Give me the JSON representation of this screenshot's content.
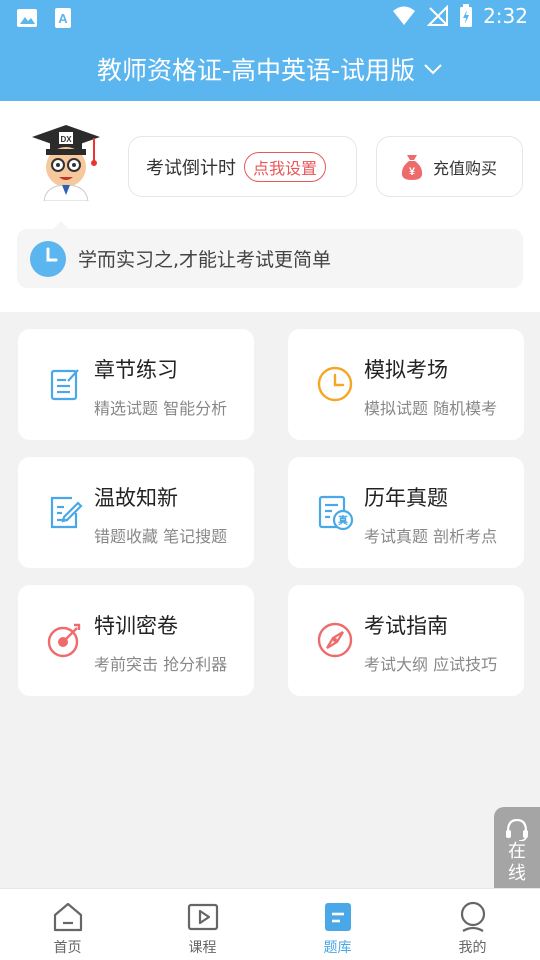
{
  "status_bar": {
    "time": "2:32",
    "left_icons": [
      "image-icon",
      "a-letter-icon"
    ],
    "right_icons": [
      "wifi-icon",
      "no-signal-icon",
      "battery-charging-icon"
    ]
  },
  "header": {
    "title": "教师资格证-高中英语-试用版",
    "dropdown_icon": "chevron-down-icon"
  },
  "profile": {
    "countdown_label": "考试倒计时",
    "set_button": "点我设置",
    "recharge_label": "充值购买"
  },
  "motto": {
    "text": "学而实习之,才能让考试更简单"
  },
  "features": [
    {
      "title": "章节练习",
      "subtitle": "精选试题 智能分析",
      "icon": "edit-note-icon"
    },
    {
      "title": "模拟考场",
      "subtitle": "模拟试题 随机模考",
      "icon": "clock-icon"
    },
    {
      "title": "温故知新",
      "subtitle": "错题收藏 笔记搜题",
      "icon": "write-icon"
    },
    {
      "title": "历年真题",
      "subtitle": "考试真题 剖析考点",
      "icon": "past-paper-icon"
    },
    {
      "title": "特训密卷",
      "subtitle": "考前突击 抢分利器",
      "icon": "target-icon"
    },
    {
      "title": "考试指南",
      "subtitle": "考试大纲 应试技巧",
      "icon": "compass-icon"
    }
  ],
  "online_service": {
    "label": "在线"
  },
  "bottom_nav": [
    {
      "label": "首页",
      "icon": "home-icon",
      "active": false
    },
    {
      "label": "课程",
      "icon": "play-icon",
      "active": false
    },
    {
      "label": "题库",
      "icon": "question-bank-icon",
      "active": true
    },
    {
      "label": "我的",
      "icon": "user-icon",
      "active": false
    }
  ],
  "colors": {
    "primary": "#5bb5ee",
    "accent_red": "#e8585a",
    "icon_blue": "#4aa8e8",
    "icon_orange": "#f6a623",
    "icon_pink": "#ef6b6b"
  }
}
